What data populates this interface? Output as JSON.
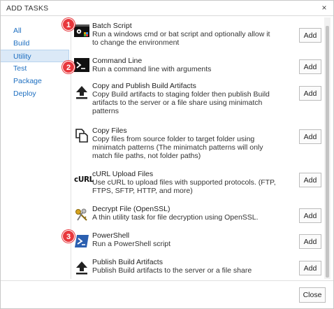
{
  "dialog": {
    "title": "ADD TASKS",
    "close_glyph": "×"
  },
  "nav": {
    "items": [
      {
        "label": "All"
      },
      {
        "label": "Build"
      },
      {
        "label": "Utility",
        "selected": true
      },
      {
        "label": "Test"
      },
      {
        "label": "Package"
      },
      {
        "label": "Deploy"
      }
    ]
  },
  "tasks": [
    {
      "name": "Batch Script",
      "description": "Run a windows cmd or bat script and optionally allow it to change the environment",
      "icon": "batch-script-icon",
      "add_label": "Add"
    },
    {
      "name": "Command Line",
      "description": "Run a command line with arguments",
      "icon": "command-line-icon",
      "add_label": "Add"
    },
    {
      "name": "Copy and Publish Build Artifacts",
      "description": "Copy Build artifacts to staging folder then publish Build artifacts to the server or a file share using minimatch patterns",
      "icon": "upload-arrow-icon",
      "add_label": "Add"
    },
    {
      "name": "Copy Files",
      "description": "Copy files from source folder to target folder using minimatch patterns (The minimatch patterns will only match file paths, not folder paths)",
      "icon": "copy-files-icon",
      "add_label": "Add"
    },
    {
      "name": "cURL Upload Files",
      "description": "Use cURL to upload files with supported protocols. (FTP, FTPS, SFTP, HTTP, and more)",
      "icon": "curl-icon",
      "icon_text": "cURL",
      "add_label": "Add"
    },
    {
      "name": "Decrypt File (OpenSSL)",
      "description": "A thin utility task for file decryption using OpenSSL.",
      "icon": "keys-icon",
      "add_label": "Add"
    },
    {
      "name": "PowerShell",
      "description": "Run a PowerShell script",
      "icon": "powershell-icon",
      "add_label": "Add"
    },
    {
      "name": "Publish Build Artifacts",
      "description": "Publish Build artifacts to the server or a file share",
      "icon": "upload-arrow-icon",
      "add_label": "Add"
    }
  ],
  "callouts": [
    "1",
    "2",
    "3"
  ],
  "footer": {
    "close_label": "Close"
  },
  "colors": {
    "link": "#1e6fc0",
    "selected_bg": "#dbe9f7",
    "callout": "#e8383d"
  }
}
